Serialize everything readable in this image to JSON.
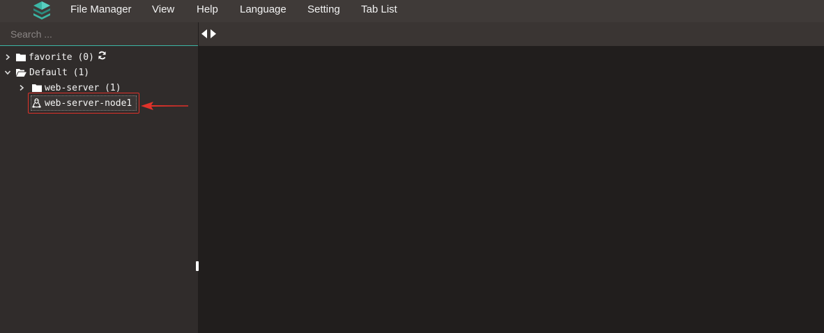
{
  "menu": {
    "items": [
      "File Manager",
      "View",
      "Help",
      "Language",
      "Setting",
      "Tab List"
    ]
  },
  "search": {
    "placeholder": "Search ..."
  },
  "tree": {
    "favorite_label": "favorite (0)",
    "default_label": "Default (1)",
    "web_server_label": "web-server (1)",
    "node_label": "web-server-node1"
  },
  "colors": {
    "menubar_bg": "#3f3a38",
    "sidebar_bg": "#302c2b",
    "main_bg": "#211e1d",
    "accent_teal": "#3cb6a5",
    "annotation_red": "#e0322a"
  },
  "icons": {
    "logo": "stacked-layers-logo",
    "refresh": "refresh-icon",
    "folder": "folder-icon",
    "folder_open": "folder-open-icon",
    "linux": "linux-tux-icon",
    "tab_prev": "caret-left-icon",
    "tab_next": "caret-right-icon"
  }
}
